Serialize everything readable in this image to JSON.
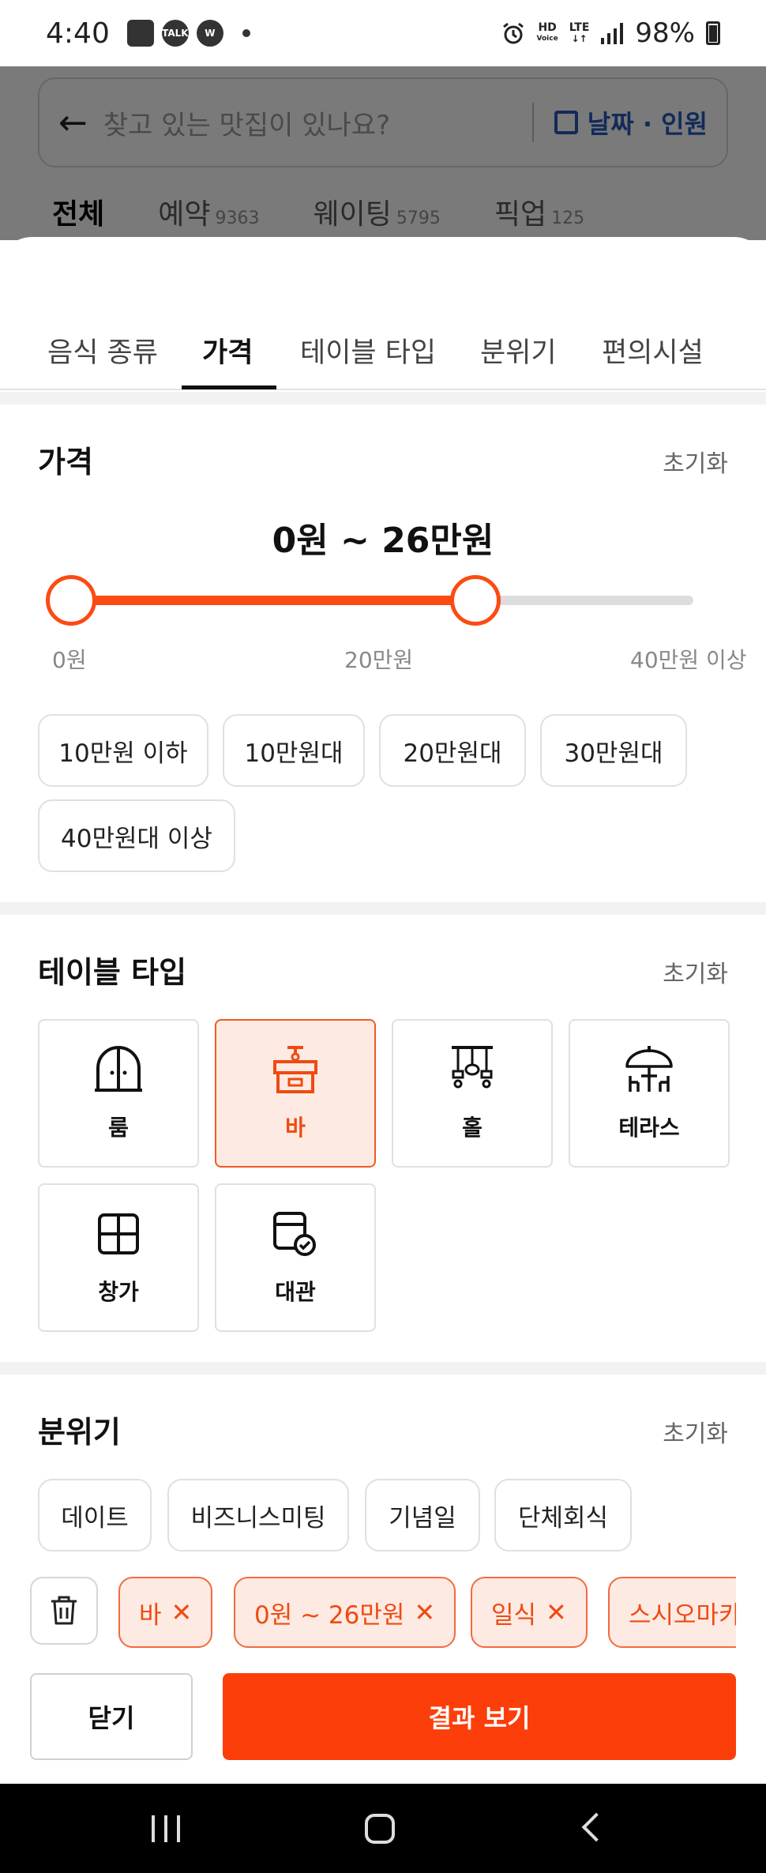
{
  "status_bar": {
    "time": "4:40",
    "talk_label": "TALK",
    "w_label": "W",
    "hd_label": "HD",
    "voice_label": "Voice",
    "lte_label": "LTE",
    "battery": "98%"
  },
  "background": {
    "search_placeholder": "찾고 있는 맛집이 있나요?",
    "date_people_label": "날짜 · 인원",
    "tabs": [
      {
        "label": "전체",
        "count": ""
      },
      {
        "label": "예약",
        "count": "9363"
      },
      {
        "label": "웨이팅",
        "count": "5795"
      },
      {
        "label": "픽업",
        "count": "125"
      }
    ]
  },
  "filter_tabs": [
    "음식 종류",
    "가격",
    "테이블 타입",
    "분위기",
    "편의시설"
  ],
  "active_filter_tab": "가격",
  "price": {
    "title": "가격",
    "reset_label": "초기화",
    "range_text": "0원 ~ 26만원",
    "slider_min_label": "0원",
    "slider_mid_label": "20만원",
    "slider_max_label": "40만원 이상",
    "slider_low_fraction": 0.0,
    "slider_high_fraction": 0.65,
    "chips": [
      "10만원 이하",
      "10만원대",
      "20만원대",
      "30만원대",
      "40만원대 이상"
    ]
  },
  "table_type": {
    "title": "테이블 타입",
    "reset_label": "초기화",
    "options": [
      {
        "label": "룸",
        "icon": "door-arch-icon",
        "selected": false
      },
      {
        "label": "바",
        "icon": "bar-counter-icon",
        "selected": true
      },
      {
        "label": "홀",
        "icon": "hall-lamps-icon",
        "selected": false
      },
      {
        "label": "테라스",
        "icon": "terrace-umbrella-icon",
        "selected": false
      },
      {
        "label": "창가",
        "icon": "window-icon",
        "selected": false
      },
      {
        "label": "대관",
        "icon": "rental-calendar-icon",
        "selected": false
      }
    ]
  },
  "mood": {
    "title": "분위기",
    "reset_label": "초기화",
    "chips": [
      "데이트",
      "비즈니스미팅",
      "기념일",
      "단체회식"
    ]
  },
  "selected_filters": [
    "바",
    "0원 ~ 26만원",
    "일식",
    "스시오마카세"
  ],
  "remove_symbol": "✕",
  "buttons": {
    "close": "닫기",
    "results": "결과 보기"
  },
  "colors": {
    "accent": "#FC3E0A",
    "accent_light": "#FDEAE3",
    "dim_overlay": "#7A7A7A"
  }
}
